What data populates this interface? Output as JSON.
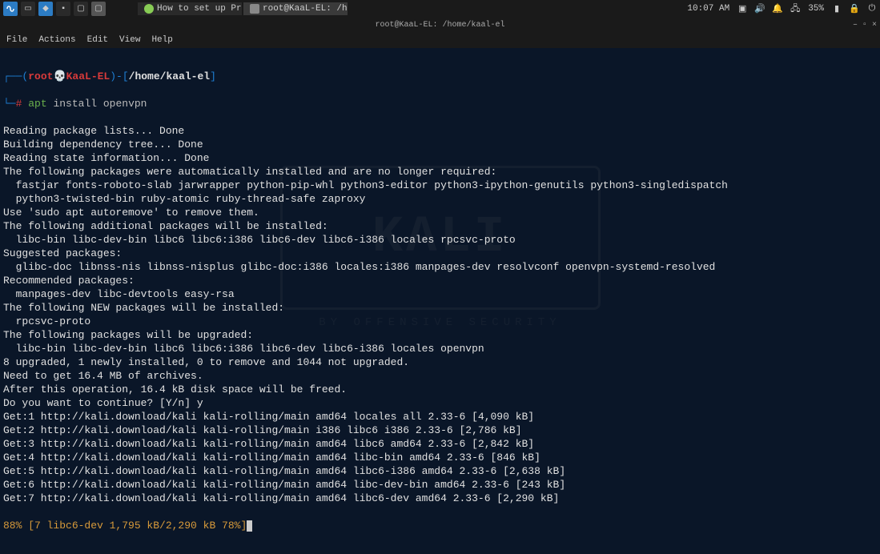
{
  "taskbar": {
    "tabs": [
      {
        "label": "How to set up ProtonVP..."
      },
      {
        "label": "root@KaaL-EL: /home/k..."
      }
    ],
    "clock": "10:07 AM",
    "battery": "35%"
  },
  "titlebar": {
    "title": "root@KaaL-EL: /home/kaal-el"
  },
  "menubar": {
    "items": [
      "File",
      "Actions",
      "Edit",
      "View",
      "Help"
    ]
  },
  "prompt": {
    "user": "root",
    "host": "KaaL-EL",
    "path": "/home/kaal-el",
    "hash": "#"
  },
  "command": {
    "bin": "apt",
    "args": "install openvpn"
  },
  "output_lines": [
    "Reading package lists... Done",
    "Building dependency tree... Done",
    "Reading state information... Done",
    "The following packages were automatically installed and are no longer required:",
    "  fastjar fonts-roboto-slab jarwrapper python-pip-whl python3-editor python3-ipython-genutils python3-singledispatch",
    "  python3-twisted-bin ruby-atomic ruby-thread-safe zaproxy",
    "Use 'sudo apt autoremove' to remove them.",
    "The following additional packages will be installed:",
    "  libc-bin libc-dev-bin libc6 libc6:i386 libc6-dev libc6-i386 locales rpcsvc-proto",
    "Suggested packages:",
    "  glibc-doc libnss-nis libnss-nisplus glibc-doc:i386 locales:i386 manpages-dev resolvconf openvpn-systemd-resolved",
    "Recommended packages:",
    "  manpages-dev libc-devtools easy-rsa",
    "The following NEW packages will be installed:",
    "  rpcsvc-proto",
    "The following packages will be upgraded:",
    "  libc-bin libc-dev-bin libc6 libc6:i386 libc6-dev libc6-i386 locales openvpn",
    "8 upgraded, 1 newly installed, 0 to remove and 1044 not upgraded.",
    "Need to get 16.4 MB of archives.",
    "After this operation, 16.4 kB disk space will be freed.",
    "Do you want to continue? [Y/n] y",
    "Get:1 http://kali.download/kali kali-rolling/main amd64 locales all 2.33-6 [4,090 kB]",
    "Get:2 http://kali.download/kali kali-rolling/main i386 libc6 i386 2.33-6 [2,786 kB]",
    "Get:3 http://kali.download/kali kali-rolling/main amd64 libc6 amd64 2.33-6 [2,842 kB]",
    "Get:4 http://kali.download/kali kali-rolling/main amd64 libc-bin amd64 2.33-6 [846 kB]",
    "Get:5 http://kali.download/kali kali-rolling/main amd64 libc6-i386 amd64 2.33-6 [2,638 kB]",
    "Get:6 http://kali.download/kali kali-rolling/main amd64 libc-dev-bin amd64 2.33-6 [243 kB]",
    "Get:7 http://kali.download/kali kali-rolling/main amd64 libc6-dev amd64 2.33-6 [2,290 kB]"
  ],
  "progress_line": "88% [7 libc6-dev 1,795 kB/2,290 kB 78%]",
  "watermark": {
    "title": "KALI",
    "subtitle": "BY OFFENSIVE SECURITY"
  }
}
